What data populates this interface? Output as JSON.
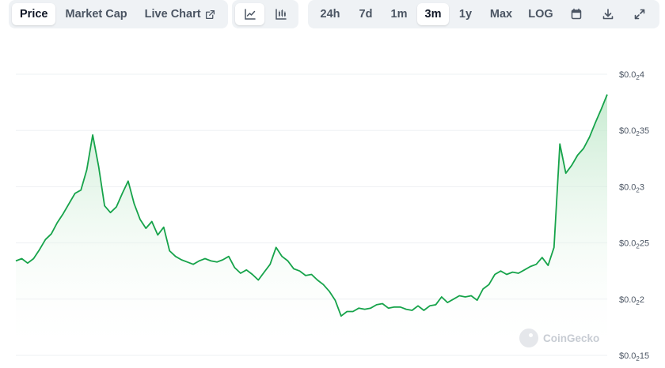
{
  "toolbar": {
    "tabs": {
      "price": "Price",
      "market_cap": "Market Cap",
      "live_chart": "Live Chart"
    },
    "chart_types": [
      "line-chart-icon",
      "candlestick-icon"
    ],
    "ranges": {
      "r24h": "24h",
      "r7d": "7d",
      "r1m": "1m",
      "r3m": "3m",
      "r1y": "1y",
      "max": "Max",
      "log": "LOG"
    },
    "active_tab": "Price",
    "active_range": "3m"
  },
  "watermark": "CoinGecko",
  "colors": {
    "line": "#16a34a",
    "fill_top": "#bde7c8",
    "grid": "#eef0f3",
    "axis_text": "#4b5563"
  },
  "chart_data": {
    "type": "area",
    "y_ticks": [
      {
        "value": 0.004,
        "lead": "$0.0",
        "sub": "2",
        "tail": "4"
      },
      {
        "value": 0.0035,
        "lead": "$0.0",
        "sub": "2",
        "tail": "35"
      },
      {
        "value": 0.003,
        "lead": "$0.0",
        "sub": "2",
        "tail": "3"
      },
      {
        "value": 0.0025,
        "lead": "$0.0",
        "sub": "2",
        "tail": "25"
      },
      {
        "value": 0.002,
        "lead": "$0.0",
        "sub": "2",
        "tail": "2"
      },
      {
        "value": 0.0015,
        "lead": "$0.0",
        "sub": "2",
        "tail": "15"
      }
    ],
    "ylim": [
      0.0015,
      0.004
    ],
    "x": [
      0,
      1,
      2,
      3,
      4,
      5,
      6,
      7,
      8,
      9,
      10,
      11,
      12,
      13,
      14,
      15,
      16,
      17,
      18,
      19,
      20,
      21,
      22,
      23,
      24,
      25,
      26,
      27,
      28,
      29,
      30,
      31,
      32,
      33,
      34,
      35,
      36,
      37,
      38,
      39,
      40,
      41,
      42,
      43,
      44,
      45,
      46,
      47,
      48,
      49,
      50,
      51,
      52,
      53,
      54,
      55,
      56,
      57,
      58,
      59,
      60,
      61,
      62,
      63,
      64,
      65,
      66,
      67,
      68,
      69,
      70,
      71,
      72,
      73,
      74,
      75,
      76,
      77,
      78,
      79,
      80,
      81,
      82,
      83,
      84,
      85,
      86,
      87,
      88,
      89,
      90,
      91,
      92,
      93,
      94,
      95,
      96,
      97,
      98,
      99,
      100
    ],
    "values": [
      0.00234,
      0.00236,
      0.00232,
      0.00236,
      0.00244,
      0.00253,
      0.00258,
      0.00268,
      0.00276,
      0.00285,
      0.00294,
      0.00297,
      0.00315,
      0.00346,
      0.00318,
      0.00283,
      0.00277,
      0.00282,
      0.00294,
      0.00305,
      0.00285,
      0.00271,
      0.00263,
      0.00269,
      0.00257,
      0.00264,
      0.00243,
      0.00238,
      0.00235,
      0.00233,
      0.00231,
      0.00234,
      0.00236,
      0.00234,
      0.00233,
      0.00235,
      0.00238,
      0.00228,
      0.00223,
      0.00226,
      0.00222,
      0.00217,
      0.00224,
      0.00231,
      0.00246,
      0.00238,
      0.00234,
      0.00227,
      0.00225,
      0.00221,
      0.00222,
      0.00217,
      0.00213,
      0.00207,
      0.00199,
      0.00185,
      0.00189,
      0.00189,
      0.00192,
      0.00191,
      0.00192,
      0.00195,
      0.00196,
      0.00192,
      0.00193,
      0.00193,
      0.00191,
      0.0019,
      0.00194,
      0.0019,
      0.00194,
      0.00195,
      0.00202,
      0.00197,
      0.002,
      0.00203,
      0.00202,
      0.00203,
      0.00199,
      0.00209,
      0.00213,
      0.00222,
      0.00225,
      0.00222,
      0.00224,
      0.00223,
      0.00226,
      0.00229,
      0.00231,
      0.00237,
      0.0023,
      0.00246,
      0.00338,
      0.00312,
      0.00319,
      0.00328,
      0.00334,
      0.00344,
      0.00357,
      0.00369,
      0.00382
    ]
  }
}
